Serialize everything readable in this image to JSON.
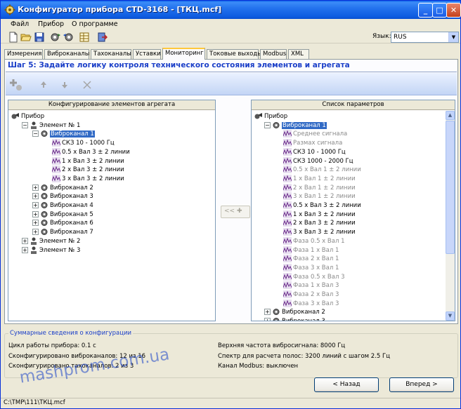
{
  "window": {
    "title": "Конфигуратор прибора CTD-3168 - [ТКЦ.mcf]",
    "minimize": "_",
    "maximize": "□",
    "close": "✕"
  },
  "menu": [
    "Файл",
    "Прибор",
    "О программе"
  ],
  "toolbar": {
    "language_label": "Язык:",
    "language_value": "RUS"
  },
  "tabs": [
    "Измерения",
    "Виброканалы",
    "Тахоканалы",
    "Уставки",
    "Мониторинг",
    "Токовые выходы",
    "Modbus",
    "XML"
  ],
  "active_tab": "Мониторинг",
  "step_title": "Шаг 5: Задайте логику контроля технического состояния элементов и агрегата",
  "left_pane": {
    "header": "Конфигурирование элементов агрегата",
    "rows": [
      {
        "label": "Прибор",
        "level": 0,
        "icon": "device",
        "exp": ""
      },
      {
        "label": "Элемент № 1",
        "level": 1,
        "icon": "element",
        "exp": "−"
      },
      {
        "label": "Виброканал 1",
        "level": 2,
        "icon": "channel",
        "exp": "−",
        "selected": true
      },
      {
        "label": "СКЗ 10 - 1000 Гц",
        "level": 3,
        "icon": "param",
        "exp": ""
      },
      {
        "label": "0.5 x Вал 3 ± 2 линии",
        "level": 3,
        "icon": "param",
        "exp": ""
      },
      {
        "label": "1 x Вал 3 ± 2 линии",
        "level": 3,
        "icon": "param",
        "exp": ""
      },
      {
        "label": "2 x Вал 3 ± 2 линии",
        "level": 3,
        "icon": "param",
        "exp": ""
      },
      {
        "label": "3 x Вал 3 ± 2 линии",
        "level": 3,
        "icon": "param",
        "exp": ""
      },
      {
        "label": "Виброканал 2",
        "level": 2,
        "icon": "channel",
        "exp": "+"
      },
      {
        "label": "Виброканал 3",
        "level": 2,
        "icon": "channel",
        "exp": "+"
      },
      {
        "label": "Виброканал 4",
        "level": 2,
        "icon": "channel",
        "exp": "+"
      },
      {
        "label": "Виброканал 5",
        "level": 2,
        "icon": "channel",
        "exp": "+"
      },
      {
        "label": "Виброканал 6",
        "level": 2,
        "icon": "channel",
        "exp": "+"
      },
      {
        "label": "Виброканал 7",
        "level": 2,
        "icon": "channel",
        "exp": "+"
      },
      {
        "label": "Элемент № 2",
        "level": 1,
        "icon": "element",
        "exp": "+"
      },
      {
        "label": "Элемент № 3",
        "level": 1,
        "icon": "element",
        "exp": "+"
      }
    ]
  },
  "middle_button": "<< ✚",
  "right_pane": {
    "header": "Список параметров",
    "rows": [
      {
        "label": "Прибор",
        "level": 0,
        "icon": "device",
        "exp": ""
      },
      {
        "label": "Виброканал 1",
        "level": 1,
        "icon": "channel",
        "exp": "−",
        "selected": true
      },
      {
        "label": "Среднее сигнала",
        "level": 2,
        "icon": "param",
        "gray": true
      },
      {
        "label": "Размах сигнала",
        "level": 2,
        "icon": "param",
        "gray": true
      },
      {
        "label": "СКЗ 10 - 1000 Гц",
        "level": 2,
        "icon": "param"
      },
      {
        "label": "СКЗ 1000 - 2000 Гц",
        "level": 2,
        "icon": "param"
      },
      {
        "label": "0.5 x Вал 1 ± 2 линии",
        "level": 2,
        "icon": "param",
        "gray": true
      },
      {
        "label": "1 x Вал 1 ± 2 линии",
        "level": 2,
        "icon": "param",
        "gray": true
      },
      {
        "label": "2 x Вал 1 ± 2 линии",
        "level": 2,
        "icon": "param",
        "gray": true
      },
      {
        "label": "3 x Вал 1 ± 2 линии",
        "level": 2,
        "icon": "param",
        "gray": true
      },
      {
        "label": "0.5 x Вал 3 ± 2 линии",
        "level": 2,
        "icon": "param"
      },
      {
        "label": "1 x Вал 3 ± 2 линии",
        "level": 2,
        "icon": "param"
      },
      {
        "label": "2 x Вал 3 ± 2 линии",
        "level": 2,
        "icon": "param"
      },
      {
        "label": "3 x Вал 3 ± 2 линии",
        "level": 2,
        "icon": "param"
      },
      {
        "label": "Фаза 0.5 x Вал 1",
        "level": 2,
        "icon": "param",
        "gray": true
      },
      {
        "label": "Фаза 1 x Вал 1",
        "level": 2,
        "icon": "param",
        "gray": true
      },
      {
        "label": "Фаза 2 x Вал 1",
        "level": 2,
        "icon": "param",
        "gray": true
      },
      {
        "label": "Фаза 3 x Вал 1",
        "level": 2,
        "icon": "param",
        "gray": true
      },
      {
        "label": "Фаза 0.5 x Вал 3",
        "level": 2,
        "icon": "param",
        "gray": true
      },
      {
        "label": "Фаза 1 x Вал 3",
        "level": 2,
        "icon": "param",
        "gray": true
      },
      {
        "label": "Фаза 2 x Вал 3",
        "level": 2,
        "icon": "param",
        "gray": true
      },
      {
        "label": "Фаза 3 x Вал 3",
        "level": 2,
        "icon": "param",
        "gray": true
      },
      {
        "label": "Виброканал 2",
        "level": 1,
        "icon": "channel",
        "exp": "+"
      },
      {
        "label": "Виброканал 3",
        "level": 1,
        "icon": "channel",
        "exp": "+"
      }
    ]
  },
  "summary": {
    "title": "Суммарные сведения о конфигурации",
    "cycle": "Цикл работы прибора: 0.1 с",
    "vibro": "Сконфигурировано виброканалов: 12 из 16",
    "tacho": "Сконфигурировано тахоканалов: 2 из 3",
    "upper_freq": "Верхняя частота вибросигнала: 8000 Гц",
    "spectrum": "Спектр для расчета полос: 3200 линий с шагом 2.5 Гц",
    "modbus": "Канал Modbus: выключен"
  },
  "buttons": {
    "back": "< Назад",
    "next": "Вперед >"
  },
  "status": "C:\\TMP\\111\\ТКЦ.mcf",
  "watermark": "mashprom.com.ua"
}
